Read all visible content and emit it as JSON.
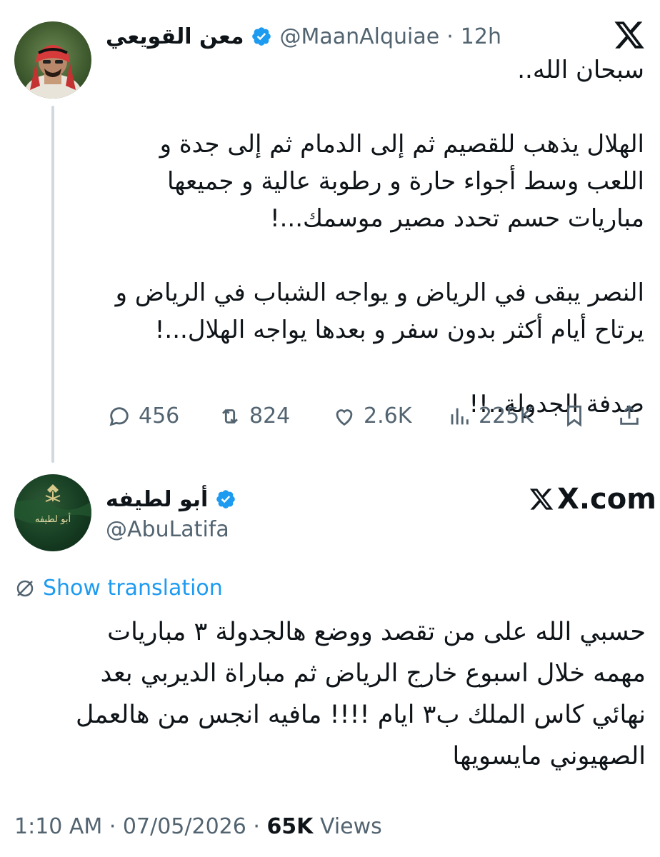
{
  "tweet1": {
    "display_name": "معن القويعي",
    "handle": "@MaanAlquiae",
    "separator": "·",
    "time": "12h",
    "body": "سبحان الله..\n\nالهلال يذهب للقصيم ثم إلى الدمام ثم إلى جدة و\nاللعب وسط أجواء حارة و رطوبة عالية و جميعها\nمباريات حسم تحدد مصير موسمك...!\n\nالنصر يبقى في الرياض و يواجه الشباب في الرياض و\nيرتاح أيام أكثر بدون سفر و بعدها يواجه الهلال...!\n\nصدفة الجدولة..!!",
    "actions": {
      "replies": "456",
      "reposts": "824",
      "likes": "2.6K",
      "views": "225K"
    },
    "icons": [
      "x-logo-icon",
      "verified-icon",
      "reply-icon",
      "repost-icon",
      "like-icon",
      "views-icon",
      "bookmark-icon",
      "share-icon"
    ]
  },
  "tweet2": {
    "display_name": "أبو لطيفه",
    "handle": "@AbuLatifa",
    "watermark": "X.com",
    "show_translation": "Show translation",
    "body": "حسبي الله على من تقصد ووضع هالجدولة ٣ مباريات\nمهمه خلال اسبوع خارج الرياض ثم مباراة الديربي بعد\nنهائي كاس الملك ب٣ ايام !!!! مافيه انجس من هالعمل\nالصهيوني مايسويها",
    "avatar_text": "أبو لطيفه",
    "timestamp": "1:10 AM · 07/05/2026 · ",
    "views_count": "65K",
    "views_label": " Views"
  },
  "colors": {
    "verified_blue": "#1d9bf0",
    "grey_text": "#536471",
    "thread_line": "#cfd9de",
    "link_blue": "#1d9bf0"
  }
}
